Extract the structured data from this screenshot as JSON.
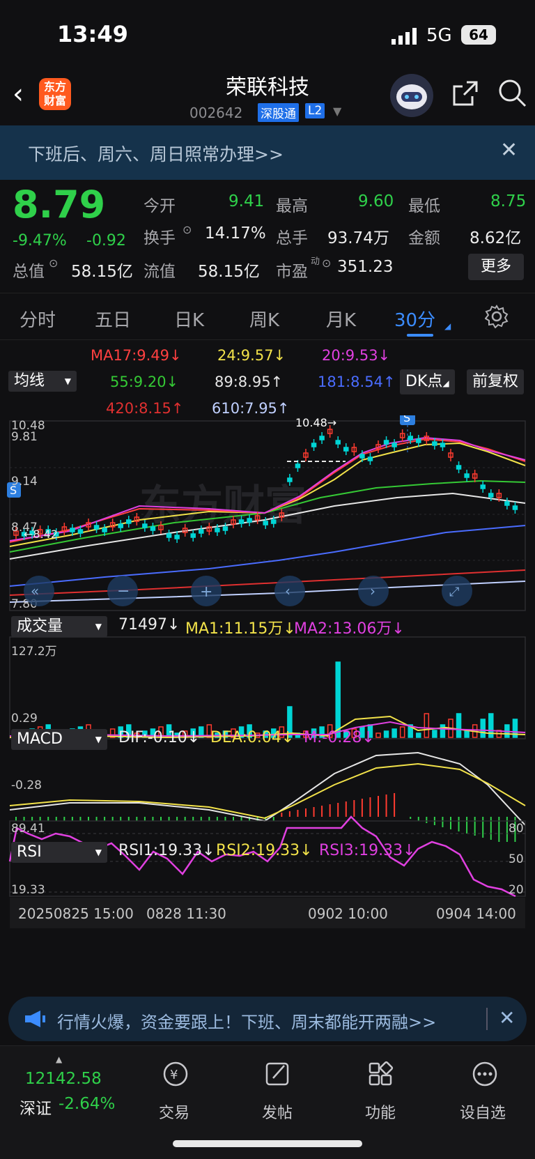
{
  "status_bar": {
    "time": "13:49",
    "network": "5G",
    "battery": "64"
  },
  "header": {
    "title": "荣联科技",
    "code": "002642",
    "tag_market": "深股通",
    "tag_level": "L2",
    "logo_text": "东方财富"
  },
  "notice": {
    "text": "下班后、周六、周日照常办理>>"
  },
  "quote": {
    "price": "8.79",
    "change_pct": "-9.47%",
    "change": "-0.92",
    "open_label": "今开",
    "open": "9.41",
    "high_label": "最高",
    "high": "9.60",
    "low_label": "最低",
    "low": "8.75",
    "turnover_label": "换手",
    "turnover": "14.17%",
    "volume_label": "总手",
    "volume": "93.74万",
    "amount_label": "金额",
    "amount": "8.62亿",
    "mktcap_label": "总值",
    "mktcap": "58.15亿",
    "float_label": "流值",
    "float": "58.15亿",
    "pe_label": "市盈",
    "pe_sup": "动",
    "pe": "351.23",
    "more_label": "更多"
  },
  "tabs": [
    "分时",
    "五日",
    "日K",
    "周K",
    "月K",
    "30分"
  ],
  "ma_legend": {
    "chip_ma": "均线",
    "chip_dk": "DK点",
    "chip_fq": "前复权",
    "items": [
      {
        "text": "MA17:9.49↓",
        "color": "#ff4040"
      },
      {
        "text": "24:9.57↓",
        "color": "#f2e24a"
      },
      {
        "text": "20:9.53↓",
        "color": "#e040e0"
      },
      {
        "text": "55:9.20↓",
        "color": "#35c935"
      },
      {
        "text": "89:8.95↑",
        "color": "#e6e6e6"
      },
      {
        "text": "181:8.54↑",
        "color": "#4a6cff"
      },
      {
        "text": "420:8.15↑",
        "color": "#e03030"
      },
      {
        "text": "610:7.95↑",
        "color": "#c0d0ff"
      }
    ]
  },
  "kline": {
    "y_labels": [
      "10.48",
      "9.81",
      "9.14",
      "8.47",
      "7.80"
    ],
    "max_label": "10.48→",
    "min_label": "←8.42",
    "signal": "S",
    "watermark": "东方财富"
  },
  "volume": {
    "chip": "成交量",
    "value": "71497↓",
    "ma1": "MA1:11.15万↓",
    "ma2": "MA2:13.06万↓",
    "y_label": "127.2万"
  },
  "macd": {
    "chip": "MACD",
    "dif": "DIF:-0.10↓",
    "dea": "DEA:0.04↓",
    "m": "M:-0.28↓",
    "y_top": "0.29",
    "y_bottom": "-0.28"
  },
  "rsi": {
    "chip": "RSI",
    "rsi1": "RSI1:19.33↓",
    "rsi2": "RSI2:19.33↓",
    "rsi3": "RSI3:19.33↓",
    "y_top": "89.41",
    "y_bottom": "19.33",
    "r80": "80",
    "r50": "50",
    "r20": "20"
  },
  "x_axis": [
    "20250825 15:00",
    "0828 11:30",
    "0902 10:00",
    "0904 14:00"
  ],
  "banner": {
    "text": "行情火爆，资金要跟上！下班、周末都能开两融>>"
  },
  "bottom_bar": {
    "index_value": "12142.58",
    "index_name": "深证",
    "index_change": "-2.64%",
    "items": [
      "交易",
      "发帖",
      "功能",
      "设自选"
    ]
  }
}
